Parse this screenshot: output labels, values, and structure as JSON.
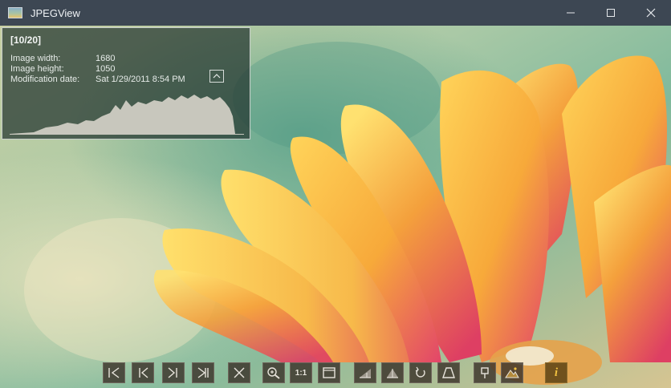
{
  "window": {
    "title": "JPEGView",
    "controls": [
      "minimize-icon",
      "maximize-icon",
      "close-icon"
    ]
  },
  "info_panel": {
    "index": "[10/20]",
    "rows": [
      {
        "label": "Image width:",
        "value": "1680"
      },
      {
        "label": "Image height:",
        "value": "1050"
      },
      {
        "label": "Modification date:",
        "value": "Sat 1/29/2011 8:54 PM"
      }
    ],
    "toggle_icon": "chevron-up-icon",
    "histogram_color": "#c8c7bd"
  },
  "toolbar": {
    "buttons": [
      {
        "name": "first-image-button",
        "icon": "skip-first-icon"
      },
      {
        "name": "previous-image-button",
        "icon": "previous-icon"
      },
      {
        "name": "next-image-button",
        "icon": "next-icon"
      },
      {
        "name": "last-image-button",
        "icon": "skip-last-icon"
      },
      {
        "name": "close-image-button",
        "icon": "close-x-icon"
      },
      {
        "name": "zoom-in-button",
        "icon": "magnifier-icon"
      },
      {
        "name": "actual-size-button",
        "icon": "one-to-one-icon",
        "label": "1:1"
      },
      {
        "name": "fit-window-button",
        "icon": "fit-window-icon"
      },
      {
        "name": "auto-correction-button",
        "icon": "histogram-adjust-icon"
      },
      {
        "name": "local-density-button",
        "icon": "contrast-adjust-icon"
      },
      {
        "name": "rotate-button",
        "icon": "rotate-icon"
      },
      {
        "name": "perspective-button",
        "icon": "perspective-icon"
      },
      {
        "name": "keep-parameters-button",
        "icon": "pin-icon"
      },
      {
        "name": "landscape-enhancer-button",
        "icon": "landscape-icon"
      },
      {
        "name": "info-button",
        "icon": "info-icon",
        "label": "i"
      }
    ]
  },
  "colors": {
    "titlebar": "#3d4753",
    "panel_border": "#c9cfcc",
    "toolbar_button": "#3a322a",
    "info_accent": "#f0c040"
  }
}
